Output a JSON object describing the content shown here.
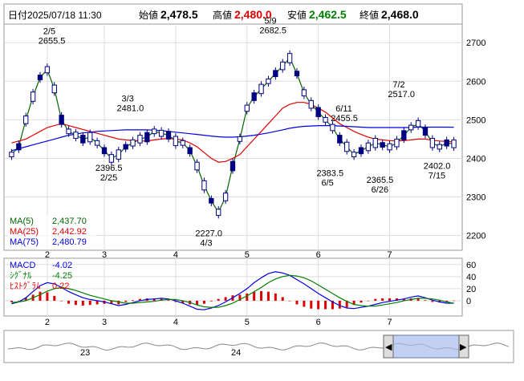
{
  "header": {
    "date_label": "日付",
    "datetime": "2025/07/18 11:30",
    "open_label": "始値",
    "open_value": "2,478.5",
    "high_label": "高値",
    "high_value": "2,480.0",
    "low_label": "安値",
    "low_value": "2,462.5",
    "close_label": "終値",
    "close_value": "2,468.0"
  },
  "colors": {
    "high": "#e00000",
    "low": "#008000",
    "ma5": "#006400",
    "ma25": "#e00000",
    "ma75": "#0000e0",
    "macd": "#0000e0",
    "signal": "#008000",
    "hist": "#e00000",
    "up_candle": "#ffffff",
    "down_candle": "#000080"
  },
  "legend": {
    "ma5_label": "MA(5)",
    "ma5_value": "2,437.70",
    "ma25_label": "MA(25)",
    "ma25_value": "2,442.92",
    "ma75_label": "MA(75)",
    "ma75_value": "2,480.79"
  },
  "macd_legend": {
    "macd_label": "MACD",
    "macd_value": "-4.02",
    "signal_label": "ｼｸﾞﾅﾙ",
    "signal_value": "-4.25",
    "hist_label": "ﾋｽﾄｸﾞﾗﾑ",
    "hist_value": "0.22"
  },
  "chart_data": [
    {
      "type": "candlestick",
      "x_label": "month",
      "month_ticks": [
        "2",
        "3",
        "4",
        "5",
        "6",
        "7"
      ],
      "ylim": [
        2170,
        2740
      ],
      "yticks": [
        2200,
        2300,
        2400,
        2500,
        2600,
        2700
      ],
      "annotations": [
        {
          "date_label": "2/5",
          "value_label": "2655.5",
          "value": 2655.5,
          "kind": "high"
        },
        {
          "date_label": "2/25",
          "value_label": "2396.5",
          "value": 2396.5,
          "kind": "low"
        },
        {
          "date_label": "3/3",
          "value_label": "2481.0",
          "value": 2481.0,
          "kind": "high"
        },
        {
          "date_label": "4/3",
          "value_label": "2227.0",
          "value": 2227.0,
          "kind": "low"
        },
        {
          "date_label": "5/9",
          "value_label": "2682.5",
          "value": 2682.5,
          "kind": "high"
        },
        {
          "date_label": "6/5",
          "value_label": "2383.5",
          "value": 2383.5,
          "kind": "low"
        },
        {
          "date_label": "6/11",
          "value_label": "2455.5",
          "value": 2455.5,
          "kind": "high"
        },
        {
          "date_label": "6/26",
          "value_label": "2365.5",
          "value": 2365.5,
          "kind": "low"
        },
        {
          "date_label": "7/2",
          "value_label": "2517.0",
          "value": 2517.0,
          "kind": "high"
        },
        {
          "date_label": "7/15",
          "value_label": "2402.0",
          "value": 2402.0,
          "kind": "low"
        }
      ],
      "series": [
        {
          "name": "MA(5)",
          "values": [
            2410,
            2430,
            2500,
            2560,
            2610,
            2630,
            2580,
            2500,
            2470,
            2460,
            2450,
            2455,
            2440,
            2420,
            2400,
            2410,
            2430,
            2440,
            2450,
            2455,
            2470,
            2465,
            2460,
            2445,
            2440,
            2420,
            2380,
            2330,
            2290,
            2260,
            2300,
            2380,
            2450,
            2530,
            2560,
            2580,
            2600,
            2620,
            2640,
            2660,
            2620,
            2570,
            2540,
            2520,
            2500,
            2480,
            2450,
            2430,
            2410,
            2420,
            2430,
            2440,
            2435,
            2430,
            2440,
            2460,
            2480,
            2490,
            2470,
            2440,
            2430,
            2440,
            2437.7
          ]
        },
        {
          "name": "MA(25)",
          "values": [
            2440,
            2445,
            2450,
            2460,
            2470,
            2480,
            2485,
            2490,
            2485,
            2480,
            2475,
            2470,
            2465,
            2460,
            2455,
            2450,
            2448,
            2446,
            2445,
            2445,
            2448,
            2450,
            2452,
            2450,
            2448,
            2440,
            2430,
            2415,
            2400,
            2390,
            2392,
            2400,
            2410,
            2430,
            2450,
            2470,
            2490,
            2510,
            2530,
            2540,
            2545,
            2545,
            2540,
            2530,
            2520,
            2505,
            2490,
            2480,
            2470,
            2462,
            2455,
            2450,
            2448,
            2446,
            2445,
            2446,
            2448,
            2450,
            2450,
            2447,
            2445,
            2444,
            2442.92
          ]
        },
        {
          "name": "MA(75)",
          "values": [
            2420,
            2425,
            2430,
            2435,
            2440,
            2445,
            2450,
            2455,
            2460,
            2463,
            2466,
            2468,
            2470,
            2471,
            2472,
            2473,
            2474,
            2474,
            2474,
            2474,
            2473,
            2472,
            2470,
            2468,
            2466,
            2464,
            2462,
            2460,
            2458,
            2456,
            2455,
            2455,
            2456,
            2458,
            2460,
            2463,
            2466,
            2470,
            2474,
            2478,
            2481,
            2483,
            2484,
            2485,
            2485,
            2485,
            2484,
            2483,
            2482,
            2481,
            2480,
            2480,
            2480,
            2480,
            2480,
            2480,
            2480,
            2481,
            2481,
            2481,
            2481,
            2481,
            2480.79
          ]
        }
      ]
    },
    {
      "type": "line",
      "x_label": "month",
      "month_ticks": [
        "2",
        "3",
        "4",
        "5",
        "6",
        "7"
      ],
      "ylim": [
        -20,
        65
      ],
      "yticks": [
        0,
        20,
        40,
        60
      ],
      "series": [
        {
          "name": "MACD",
          "values": [
            -5,
            -2,
            5,
            15,
            25,
            30,
            28,
            22,
            15,
            10,
            5,
            2,
            0,
            -2,
            -5,
            -8,
            -6,
            -3,
            0,
            2,
            3,
            4,
            3,
            0,
            -4,
            -9,
            -14,
            -15,
            -12,
            -8,
            -2,
            5,
            12,
            20,
            30,
            38,
            45,
            48,
            46,
            42,
            35,
            28,
            20,
            12,
            5,
            -2,
            -8,
            -12,
            -13,
            -11,
            -9,
            -6,
            -3,
            -1,
            1,
            3,
            6,
            8,
            5,
            1,
            -2,
            -4,
            -4.02
          ]
        },
        {
          "name": "ｼｸﾞﾅﾙ",
          "values": [
            -3,
            -2,
            0,
            5,
            10,
            16,
            20,
            22,
            20,
            17,
            13,
            9,
            6,
            3,
            0,
            -2,
            -4,
            -4,
            -3,
            -2,
            -1,
            1,
            2,
            2,
            0,
            -3,
            -7,
            -10,
            -11,
            -11,
            -8,
            -4,
            2,
            8,
            15,
            22,
            30,
            36,
            40,
            42,
            41,
            38,
            33,
            26,
            19,
            12,
            5,
            -1,
            -6,
            -8,
            -9,
            -9,
            -7,
            -5,
            -3,
            0,
            2,
            4,
            4,
            3,
            1,
            -2,
            -4.25
          ]
        },
        {
          "name": "ﾋｽﾄｸﾞﾗﾑ",
          "values": [
            -2,
            0,
            5,
            10,
            15,
            14,
            8,
            0,
            -5,
            -7,
            -8,
            -7,
            -6,
            -5,
            -5,
            -6,
            -2,
            1,
            3,
            4,
            4,
            3,
            1,
            -2,
            -4,
            -6,
            -7,
            -5,
            -1,
            3,
            6,
            9,
            10,
            12,
            15,
            16,
            15,
            12,
            6,
            0,
            -6,
            -10,
            -13,
            -14,
            -14,
            -14,
            -13,
            -11,
            -7,
            -3,
            0,
            3,
            4,
            4,
            4,
            3,
            4,
            4,
            1,
            -2,
            -3,
            -2,
            0.22
          ]
        }
      ]
    }
  ],
  "navigator": {
    "label_left": "23",
    "label_right": "24",
    "left_arrow": "◀",
    "right_arrow": "▶"
  }
}
